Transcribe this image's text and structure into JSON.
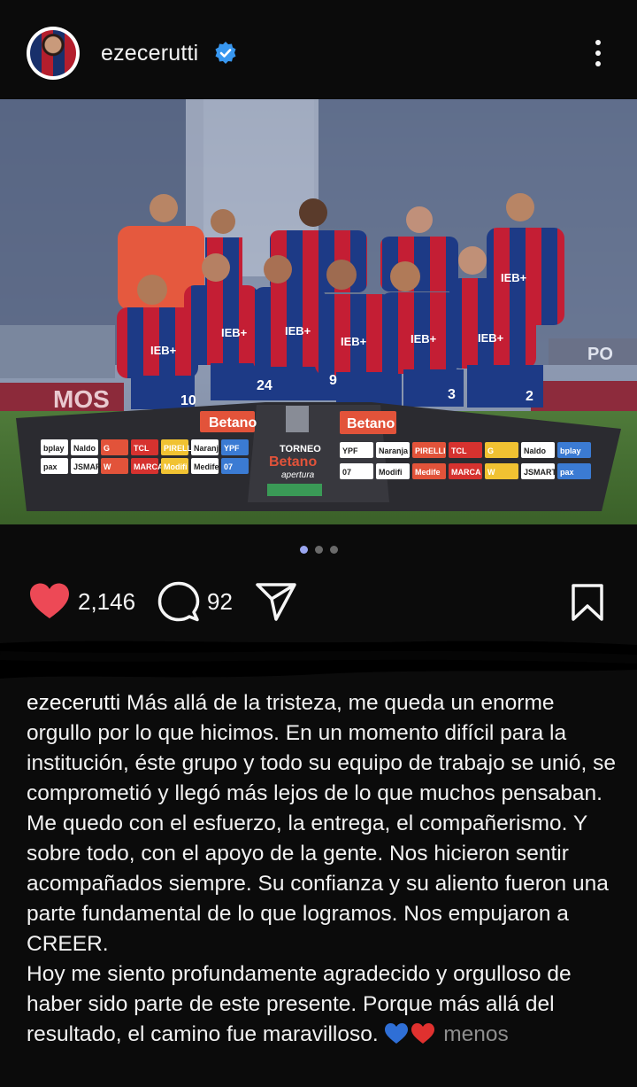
{
  "header": {
    "username": "ezecerutti",
    "verified": true,
    "avatar_icon": "avatar-icon",
    "more_icon": "more-vertical-icon"
  },
  "photo": {
    "board_left": "Betano",
    "board_right": "Betano",
    "board_center_top": "TORNEO",
    "board_center_brand": "Betano",
    "board_center_sub": "apertura",
    "sponsors_row1_left": [
      "bplay",
      "Naldo",
      "G",
      "TCL",
      "PIRELLI",
      "Naranja X",
      "YPF"
    ],
    "sponsors_row2_left": [
      "pax",
      "JSMART",
      "W",
      "MARCA",
      "Modifi",
      "Medife",
      "07"
    ],
    "sponsors_row1_right": [
      "YPF",
      "Naranja X",
      "PIRELLI",
      "TCL",
      "G",
      "Naldo",
      "bplay"
    ],
    "sponsors_row2_right": [
      "07",
      "Modifi",
      "Medife",
      "MARCA",
      "W",
      "JSMART",
      "pax"
    ],
    "shirt_sponsor": "IEB+",
    "shirt_numbers": [
      "10",
      "24",
      "9",
      "3",
      "2"
    ],
    "stadium_banner": "PO",
    "bottom_banner": "MOS"
  },
  "carousel": {
    "count": 3,
    "active": 0
  },
  "actions": {
    "likes": "2,146",
    "comments": "92",
    "icons": [
      "heart-icon",
      "comment-icon",
      "share-icon",
      "bookmark-icon"
    ],
    "like_color": "#ed4956"
  },
  "caption": {
    "username": "ezecerutti",
    "paragraph1": "Más allá de la tristeza, me queda un enorme orgullo por lo que hicimos. En un momento difícil para la institución, éste grupo y todo su equipo de trabajo se unió, se comprometió y llegó más lejos de lo que muchos pensaban.",
    "paragraph2": "Me quedo con el esfuerzo, la entrega, el compañerismo. Y sobre todo, con el apoyo de la gente. Nos hicieron sentir acompañados siempre. Su confianza y su aliento fueron una parte fundamental de lo que logramos. Nos empujaron a CREER.",
    "paragraph3": "Hoy me siento profundamente agradecido y orgulloso de haber sido parte de este presente. Porque más allá del resultado, el camino fue maravilloso.",
    "emoji_icons": [
      "blue-heart-icon",
      "red-heart-icon"
    ],
    "less_link": "menos"
  }
}
